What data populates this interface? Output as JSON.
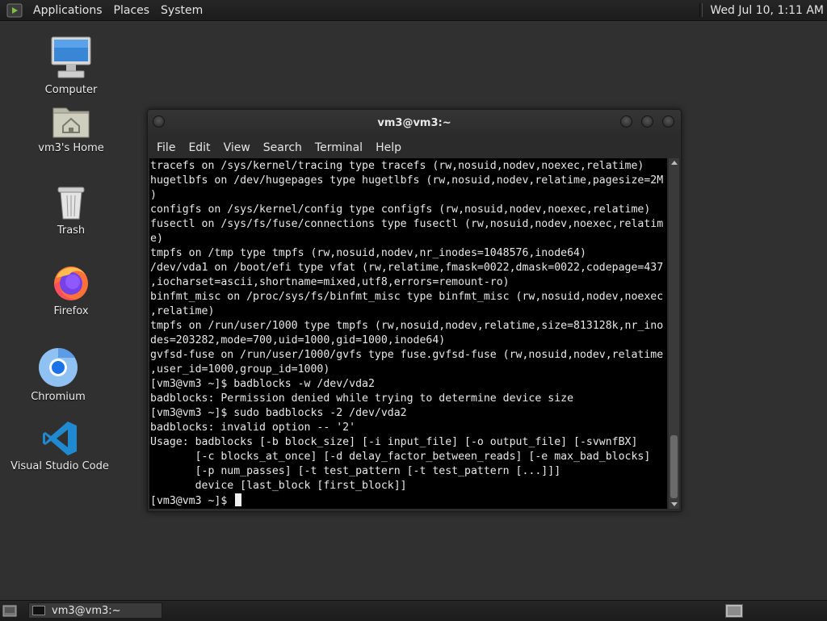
{
  "top_panel": {
    "menus": [
      "Applications",
      "Places",
      "System"
    ],
    "clock": "Wed Jul 10, 1:11 AM"
  },
  "desktop_icons": [
    {
      "label": "Computer",
      "icon": "computer-icon"
    },
    {
      "label": "vm3's Home",
      "icon": "home-folder-icon"
    },
    {
      "label": "Trash",
      "icon": "trash-icon"
    },
    {
      "label": "Firefox",
      "icon": "firefox-icon"
    },
    {
      "label": "Chromium",
      "icon": "chromium-icon"
    },
    {
      "label": "Visual Studio Code",
      "icon": "vscode-icon"
    }
  ],
  "terminal": {
    "title": "vm3@vm3:~",
    "menu": [
      "File",
      "Edit",
      "View",
      "Search",
      "Terminal",
      "Help"
    ],
    "lines": [
      "tracefs on /sys/kernel/tracing type tracefs (rw,nosuid,nodev,noexec,relatime)",
      "hugetlbfs on /dev/hugepages type hugetlbfs (rw,nosuid,nodev,relatime,pagesize=2M",
      ")",
      "configfs on /sys/kernel/config type configfs (rw,nosuid,nodev,noexec,relatime)",
      "fusectl on /sys/fs/fuse/connections type fusectl (rw,nosuid,nodev,noexec,relatim",
      "e)",
      "tmpfs on /tmp type tmpfs (rw,nosuid,nodev,nr_inodes=1048576,inode64)",
      "/dev/vda1 on /boot/efi type vfat (rw,relatime,fmask=0022,dmask=0022,codepage=437",
      ",iocharset=ascii,shortname=mixed,utf8,errors=remount-ro)",
      "binfmt_misc on /proc/sys/fs/binfmt_misc type binfmt_misc (rw,nosuid,nodev,noexec",
      ",relatime)",
      "tmpfs on /run/user/1000 type tmpfs (rw,nosuid,nodev,relatime,size=813128k,nr_ino",
      "des=203282,mode=700,uid=1000,gid=1000,inode64)",
      "gvfsd-fuse on /run/user/1000/gvfs type fuse.gvfsd-fuse (rw,nosuid,nodev,relatime",
      ",user_id=1000,group_id=1000)",
      "[vm3@vm3 ~]$ badblocks -w /dev/vda2",
      "badblocks: Permission denied while trying to determine device size",
      "[vm3@vm3 ~]$ sudo badblocks -2 /dev/vda2",
      "badblocks: invalid option -- '2'",
      "Usage: badblocks [-b block_size] [-i input_file] [-o output_file] [-svwnfBX]",
      "       [-c blocks_at_once] [-d delay_factor_between_reads] [-e max_bad_blocks]",
      "       [-p num_passes] [-t test_pattern [-t test_pattern [...]]]",
      "       device [last_block [first_block]]"
    ],
    "prompt": "[vm3@vm3 ~]$ "
  },
  "taskbar": {
    "task_label": "vm3@vm3:~"
  },
  "colors": {
    "desktop_bg": "#303030",
    "panel_bg": "#1f1f1f",
    "terminal_bg": "#000000",
    "terminal_fg": "#e8e8e8",
    "vscode_blue": "#1f8ad2",
    "firefox_orange": "#ff7139"
  }
}
